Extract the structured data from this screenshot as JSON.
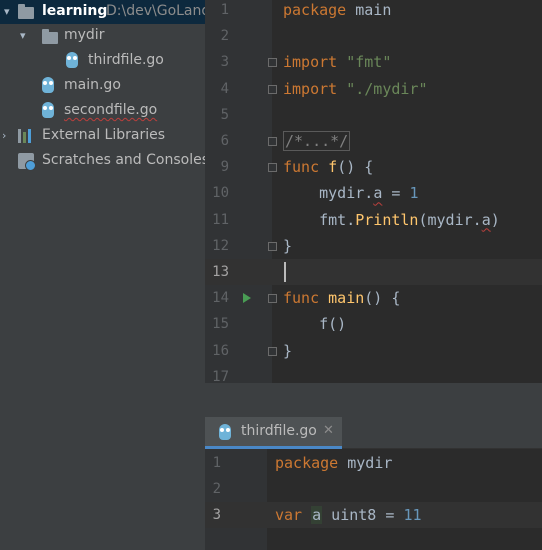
{
  "project_tree": {
    "root_name": "learning",
    "root_path": "D:\\dev\\GoLand",
    "folder_name": "mydir",
    "folder_files": [
      "thirdfile.go"
    ],
    "files": [
      "main.go",
      "secondfile.go"
    ],
    "external_libraries": "External Libraries",
    "scratches": "Scratches and Consoles"
  },
  "editor": {
    "lines": [
      {
        "n": "1",
        "tokens": [
          {
            "c": "kw",
            "t": "package"
          },
          {
            "c": "",
            "t": " main"
          }
        ]
      },
      {
        "n": "2",
        "tokens": []
      },
      {
        "n": "3",
        "tokens": [
          {
            "c": "kw",
            "t": "import"
          },
          {
            "c": "",
            "t": " "
          },
          {
            "c": "str",
            "t": "\"fmt\""
          }
        ]
      },
      {
        "n": "4",
        "tokens": [
          {
            "c": "kw",
            "t": "import"
          },
          {
            "c": "",
            "t": " "
          },
          {
            "c": "str",
            "t": "\"./mydir\""
          }
        ]
      },
      {
        "n": "5",
        "tokens": []
      },
      {
        "n": "6",
        "tokens": [
          {
            "c": "cmt",
            "t": "/*...*/"
          }
        ]
      },
      {
        "n": "9",
        "tokens": [
          {
            "c": "kw",
            "t": "func"
          },
          {
            "c": "",
            "t": " "
          },
          {
            "c": "fn",
            "t": "f"
          },
          {
            "c": "",
            "t": "() {"
          }
        ]
      },
      {
        "n": "10",
        "tokens": [
          {
            "c": "",
            "t": "    mydir."
          },
          {
            "c": "pkg",
            "t": "a"
          },
          {
            "c": "",
            "t": " = "
          },
          {
            "c": "num",
            "t": "1"
          }
        ]
      },
      {
        "n": "11",
        "tokens": [
          {
            "c": "",
            "t": "    fmt."
          },
          {
            "c": "fn",
            "t": "Println"
          },
          {
            "c": "",
            "t": "(mydir."
          },
          {
            "c": "pkg",
            "t": "a"
          },
          {
            "c": "",
            "t": ")"
          }
        ]
      },
      {
        "n": "12",
        "tokens": [
          {
            "c": "",
            "t": "}"
          }
        ]
      },
      {
        "n": "13",
        "tokens": []
      },
      {
        "n": "14",
        "tokens": [
          {
            "c": "kw",
            "t": "func"
          },
          {
            "c": "",
            "t": " "
          },
          {
            "c": "fn",
            "t": "main"
          },
          {
            "c": "",
            "t": "() {"
          }
        ]
      },
      {
        "n": "15",
        "tokens": [
          {
            "c": "",
            "t": "    f()"
          }
        ]
      },
      {
        "n": "16",
        "tokens": [
          {
            "c": "",
            "t": "}"
          }
        ]
      },
      {
        "n": "17",
        "tokens": []
      }
    ],
    "current_line": "13",
    "run_line": "14"
  },
  "second_editor": {
    "tab_label": "thirdfile.go",
    "close_glyph": "✕",
    "lines": [
      {
        "n": "1",
        "tokens": [
          {
            "c": "kw",
            "t": "package"
          },
          {
            "c": "",
            "t": " mydir"
          }
        ]
      },
      {
        "n": "2",
        "tokens": []
      },
      {
        "n": "3",
        "tokens": [
          {
            "c": "kw",
            "t": "var"
          },
          {
            "c": "",
            "t": " "
          },
          {
            "c": "hl-var",
            "t": "a"
          },
          {
            "c": "",
            "t": " uint8 = "
          },
          {
            "c": "num",
            "t": "11"
          }
        ]
      }
    ],
    "current_line": "3"
  },
  "colors": {
    "keyword": "#cc7832",
    "string": "#6a8759",
    "number": "#6897bb",
    "function": "#ffc66d",
    "panel": "#3c3f41",
    "editor": "#2b2b2b"
  }
}
